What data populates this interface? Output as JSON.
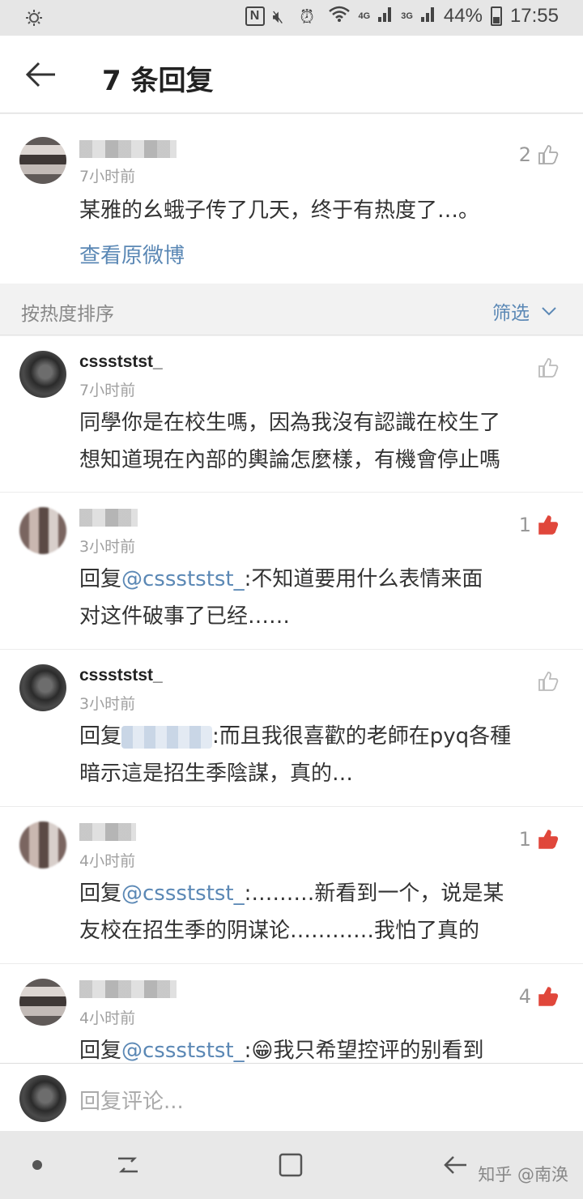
{
  "status_bar": {
    "battery": "44%",
    "time": "17:55",
    "network_4g": "4G",
    "network_3g": "3G"
  },
  "header": {
    "title": "7 条回复"
  },
  "original_post": {
    "time": "7小时前",
    "text": "某雅的幺蛾子传了几天，终于有热度了…。",
    "link": "查看原微博",
    "likes": "2"
  },
  "sort": {
    "label": "按热度排序",
    "filter": "筛选"
  },
  "comments": [
    {
      "name": "cssststst_",
      "time": "7小时前",
      "line1": "同學你是在校生嗎，因為我沒有認識在校生了",
      "line2": "想知道現在內部的輿論怎麼樣，有機會停止嗎",
      "likes": "",
      "liked": false
    },
    {
      "name": "",
      "time": "3小时前",
      "reply_prefix": "回复",
      "mention": "@cssststst_",
      "line1_rest": ":不知道要用什么表情来面",
      "line2": "对这件破事了已经……",
      "likes": "1",
      "liked": true
    },
    {
      "name": "cssststst_",
      "time": "3小时前",
      "reply_prefix": "回复",
      "line1_rest": ":而且我很喜歡的老師在pyq各種",
      "line2": "暗示這是招生季陰謀，真的…",
      "likes": "",
      "liked": false
    },
    {
      "name": "",
      "time": "4小时前",
      "reply_prefix": "回复",
      "mention": "@cssststst_",
      "line1_rest": ":………新看到一个，说是某",
      "line2": "友校在招生季的阴谋论…………我怕了真的",
      "likes": "1",
      "liked": true
    },
    {
      "name": "",
      "time": "4小时前",
      "reply_prefix": "回复",
      "mention": "@cssststst_",
      "line1_rest": ":😁我只希望控评的别看到",
      "likes": "4",
      "liked": true
    }
  ],
  "reply_bar": {
    "placeholder": "回复评论..."
  },
  "watermark": "知乎 @南涣",
  "colors": {
    "link": "#5b88b5",
    "liked": "#e0473b",
    "background": "#f2f2f2"
  }
}
